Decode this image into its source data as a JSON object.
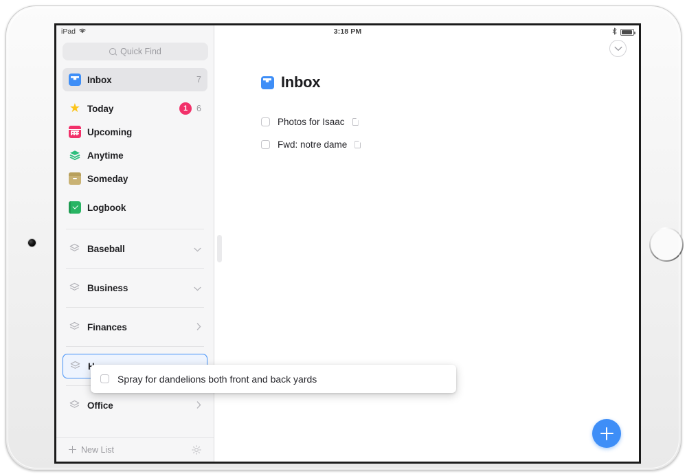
{
  "status_bar": {
    "device": "iPad",
    "wifi_icon": "wifi-icon",
    "time": "3:18 PM",
    "bluetooth_icon": "bluetooth-icon",
    "battery_icon": "battery-icon"
  },
  "sidebar": {
    "search": {
      "placeholder": "Quick Find",
      "icon": "search-icon"
    },
    "nav_items": [
      {
        "label": "Inbox",
        "icon": "inbox-icon",
        "count": "7",
        "badge": "",
        "selected": true
      },
      {
        "label": "Today",
        "icon": "star-icon",
        "count": "6",
        "badge": "1",
        "selected": false
      },
      {
        "label": "Upcoming",
        "icon": "calendar-icon",
        "count": "",
        "badge": "",
        "selected": false
      },
      {
        "label": "Anytime",
        "icon": "stack-icon",
        "count": "",
        "badge": "",
        "selected": false
      },
      {
        "label": "Someday",
        "icon": "box-icon",
        "count": "",
        "badge": "",
        "selected": false
      },
      {
        "label": "Logbook",
        "icon": "logbook-icon",
        "count": "",
        "badge": "",
        "selected": false
      }
    ],
    "lists": [
      {
        "label": "Baseball",
        "icon": "list-icon",
        "chevron": "chevron-down",
        "drop_target": false
      },
      {
        "label": "Business",
        "icon": "list-icon",
        "chevron": "chevron-down",
        "drop_target": false
      },
      {
        "label": "Finances",
        "icon": "list-icon",
        "chevron": "chevron-right",
        "drop_target": false
      },
      {
        "label": "H",
        "icon": "list-icon",
        "chevron": "",
        "drop_target": true
      },
      {
        "label": "Office",
        "icon": "list-icon",
        "chevron": "chevron-right",
        "drop_target": false
      }
    ],
    "footer": {
      "new_list_label": "New List",
      "new_list_icon": "plus-icon",
      "settings_icon": "gear-icon"
    }
  },
  "content": {
    "title": "Inbox",
    "title_icon": "inbox-icon",
    "collapse_icon": "chevron-down-icon",
    "todos": [
      {
        "text": "Photos for Isaac",
        "has_note": true,
        "checked": false
      },
      {
        "text": "Fwd: notre dame",
        "has_note": true,
        "checked": false
      }
    ],
    "add_button_icon": "plus-icon"
  },
  "drag_ghost": {
    "text": "Spray for dandelions both front and back yards",
    "checked": false
  },
  "colors": {
    "accent_blue": "#3e8ef7",
    "badge_pink": "#f2316a",
    "sidebar_bg": "#f6f6f7",
    "selected_row": "#e4e4e7"
  }
}
